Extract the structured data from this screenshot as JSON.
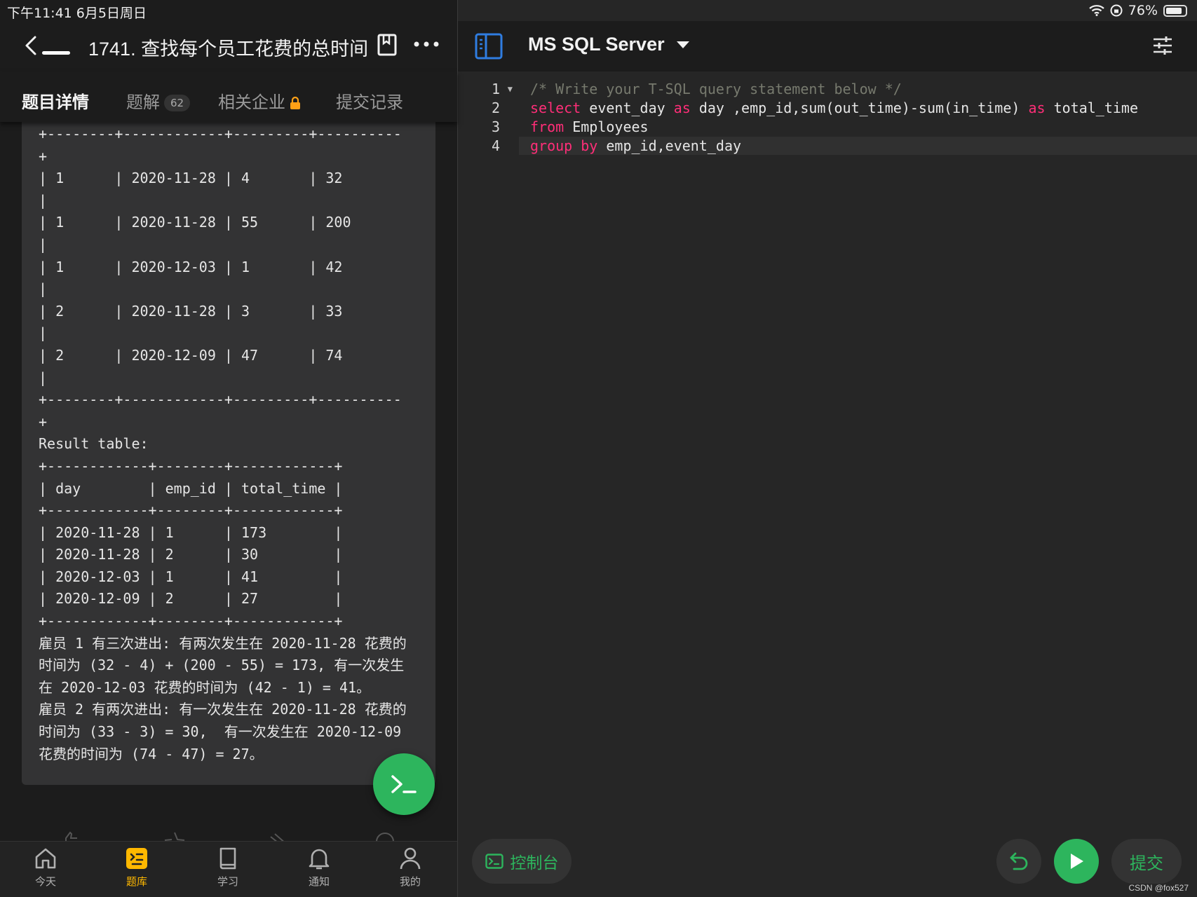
{
  "status_bar": {
    "time_date": "下午11:41   6月5日周日",
    "battery_percent": "76%"
  },
  "header": {
    "problem_title": "1741. 查找每个员工花费的总时间"
  },
  "tabs": [
    {
      "label": "题目详情",
      "active": true
    },
    {
      "label": "题解",
      "badge": "62"
    },
    {
      "label": "相关企业"
    },
    {
      "label": "提交记录"
    }
  ],
  "description_lines": [
    "+--------+------------+---------+----------",
    "+",
    "| 1      | 2020-11-28 | 4       | 32",
    "|",
    "| 1      | 2020-11-28 | 55      | 200",
    "|",
    "| 1      | 2020-12-03 | 1       | 42",
    "|",
    "| 2      | 2020-11-28 | 3       | 33",
    "|",
    "| 2      | 2020-12-09 | 47      | 74",
    "|",
    "+--------+------------+---------+----------",
    "+",
    "Result table:",
    "+------------+--------+------------+",
    "| day        | emp_id | total_time |",
    "+------------+--------+------------+",
    "| 2020-11-28 | 1      | 173        |",
    "| 2020-11-28 | 2      | 30         |",
    "| 2020-12-03 | 1      | 41         |",
    "| 2020-12-09 | 2      | 27         |",
    "+------------+--------+------------+",
    "雇员 1 有三次进出: 有两次发生在 2020-11-28 花费的",
    "时间为 (32 - 4) + (200 - 55) = 173, 有一次发生",
    "在 2020-12-03 花费的时间为 (42 - 1) = 41。",
    "雇员 2 有两次进出: 有一次发生在 2020-11-28 花费的",
    "时间为 (33 - 3) = 30,  有一次发生在 2020-12-09",
    "花费的时间为 (74 - 47) = 27。"
  ],
  "bottom_nav": [
    {
      "label": "今天",
      "icon": "home-icon"
    },
    {
      "label": "题库",
      "icon": "problem-bank-icon",
      "active": true
    },
    {
      "label": "学习",
      "icon": "book-icon"
    },
    {
      "label": "通知",
      "icon": "bell-icon"
    },
    {
      "label": "我的",
      "icon": "person-icon"
    }
  ],
  "editor": {
    "language": "MS SQL Server",
    "line_numbers": [
      "1",
      "2",
      "3",
      "4"
    ],
    "lines": [
      [
        {
          "t": "/* Write your T-SQL query statement below */",
          "c": "cmt"
        }
      ],
      [
        {
          "t": "select",
          "c": "kw"
        },
        {
          "t": " event_day ",
          "c": ""
        },
        {
          "t": "as",
          "c": "kw"
        },
        {
          "t": " day ,emp_id,sum(out_time)-sum(in_time) ",
          "c": ""
        },
        {
          "t": "as",
          "c": "kw"
        },
        {
          "t": " total_time",
          "c": ""
        }
      ],
      [
        {
          "t": "from",
          "c": "kw"
        },
        {
          "t": " Employees",
          "c": ""
        }
      ],
      [
        {
          "t": "group by",
          "c": "kw"
        },
        {
          "t": " emp_id,event_day",
          "c": ""
        }
      ]
    ]
  },
  "toolbar": {
    "console_label": "控制台",
    "submit_label": "提交"
  },
  "watermark": "CSDN @fox527",
  "colors": {
    "accent_green": "#2db55d",
    "keyword_pink": "#ff2e78",
    "active_tab_yellow": "#ffb800"
  }
}
